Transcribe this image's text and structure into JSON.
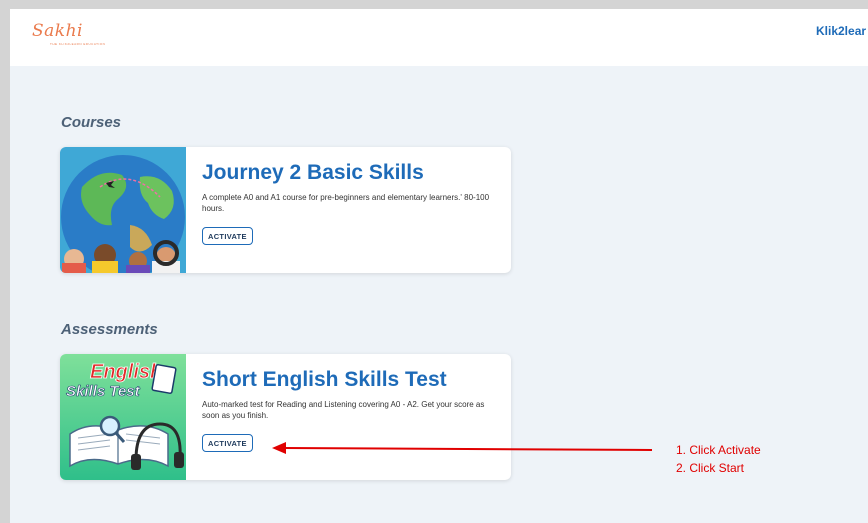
{
  "header": {
    "logo_text": "Sakhi",
    "logo_subtext": "THE KLIK2LEARN EDUCATION",
    "brand_link": "Klik2lear"
  },
  "courses": {
    "title": "Courses",
    "items": [
      {
        "title": "Journey 2 Basic Skills",
        "description": "A complete A0 and A1 course for pre-beginners and elementary learners.' 80-100 hours.",
        "button": "ACTIVATE"
      }
    ]
  },
  "assessments": {
    "title": "Assessments",
    "items": [
      {
        "title": "Short English Skills Test",
        "description": "Auto-marked test for Reading and Listening covering A0 - A2. Get your score as soon as you finish.",
        "button": "ACTIVATE",
        "thumb_line1": "English",
        "thumb_line2": "Skills Test"
      }
    ]
  },
  "annotation": {
    "step1": "1. Click Activate",
    "step2": "2. Click Start",
    "color": "#e00000"
  },
  "colors": {
    "accent": "#1e6bb8",
    "page_bg": "#eef3f8",
    "section_title": "#4d6177"
  }
}
